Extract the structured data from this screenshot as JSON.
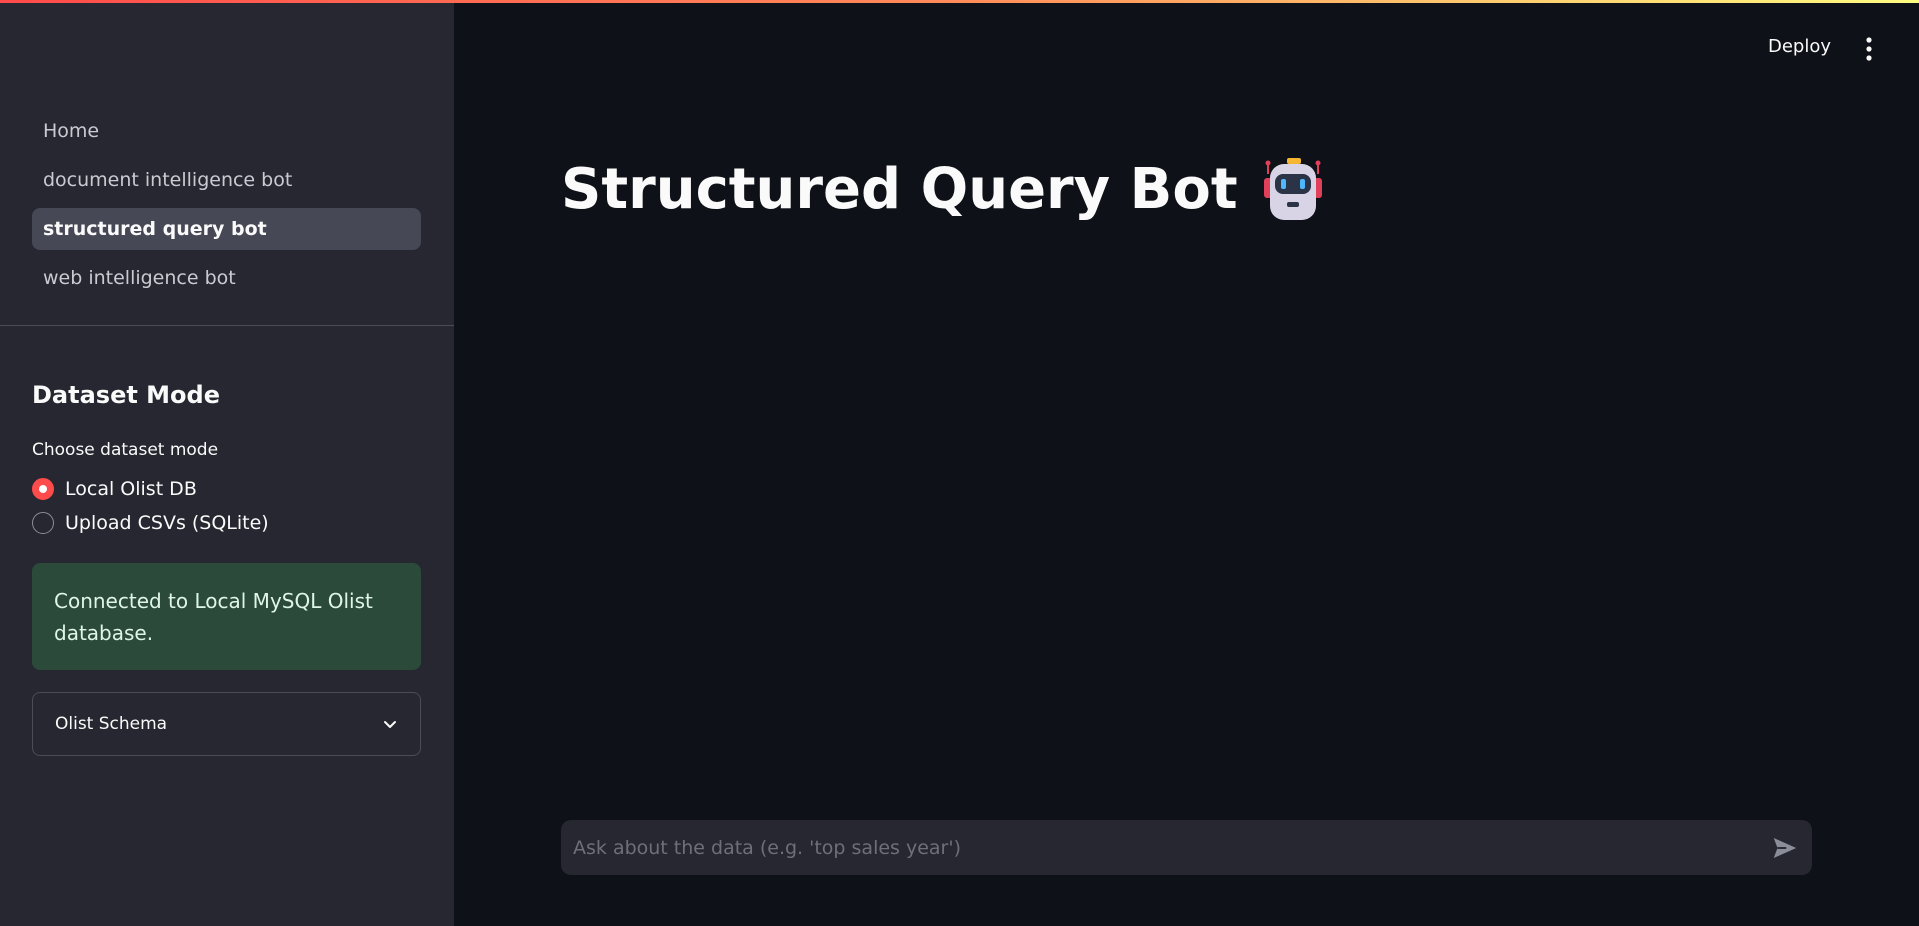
{
  "sidebar": {
    "nav": [
      {
        "label": "Home",
        "active": false
      },
      {
        "label": "document intelligence bot",
        "active": false
      },
      {
        "label": "structured query bot",
        "active": true
      },
      {
        "label": "web intelligence bot",
        "active": false
      }
    ],
    "heading": "Dataset Mode",
    "radio_label": "Choose dataset mode",
    "radio_options": [
      {
        "label": "Local Olist DB",
        "selected": true
      },
      {
        "label": "Upload CSVs (SQLite)",
        "selected": false
      }
    ],
    "success_message": "Connected to Local MySQL Olist database.",
    "expander_label": "Olist Schema"
  },
  "header": {
    "deploy_label": "Deploy",
    "menu_icon": "kebab-menu-icon"
  },
  "main": {
    "title": "Structured Query Bot",
    "title_icon": "robot-icon"
  },
  "chat": {
    "placeholder": "Ask about the data (e.g. 'top sales year')",
    "value": "",
    "send_icon": "send-icon"
  },
  "colors": {
    "accent": "#ff4b4b",
    "background": "#0e1117",
    "sidebar": "#262730",
    "success_bg": "#2b4a3a"
  }
}
